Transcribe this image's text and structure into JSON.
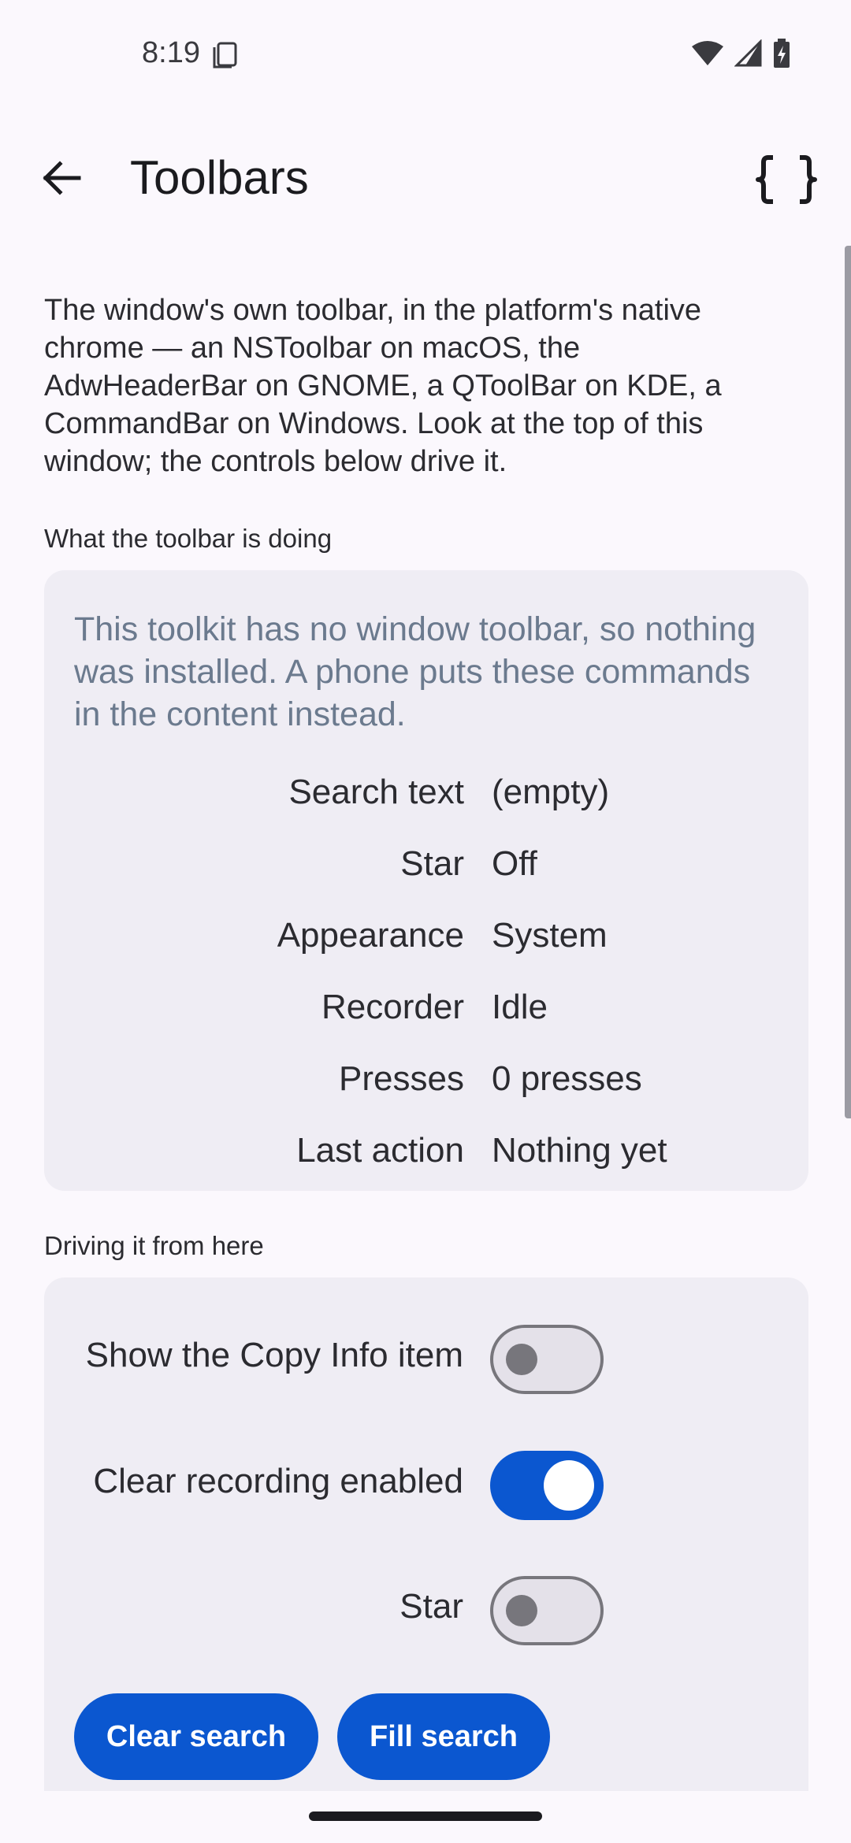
{
  "status_bar": {
    "time": "8:19",
    "icons": [
      "sim-card-icon",
      "wifi-icon",
      "cellular-signal-icon",
      "battery-charging-icon"
    ]
  },
  "app_bar": {
    "title": "Toolbars",
    "back_icon": "arrow-back-icon",
    "action_icon": "curly-braces-icon"
  },
  "intro_text": "The window's own toolbar, in the platform's native chrome — an NSToolbar on macOS, the AdwHeaderBar on GNOME, a QToolBar on KDE, a CommandBar on Windows. Look at the top of this window; the controls below drive it.",
  "status_section": {
    "label": "What the toolbar is doing",
    "message": "This toolkit has no window toolbar, so nothing was installed. A phone puts these commands in the content instead.",
    "rows": [
      {
        "key": "Search text",
        "value": "(empty)"
      },
      {
        "key": "Star",
        "value": "Off"
      },
      {
        "key": "Appearance",
        "value": "System"
      },
      {
        "key": "Recorder",
        "value": "Idle"
      },
      {
        "key": "Presses",
        "value": "0 presses"
      },
      {
        "key": "Last action",
        "value": "Nothing yet"
      }
    ]
  },
  "controls_section": {
    "label": "Driving it from here",
    "toggles": [
      {
        "label": "Show the Copy Info item",
        "state": "off"
      },
      {
        "label": "Clear recording enabled",
        "state": "on"
      },
      {
        "label": "Star",
        "state": "off"
      }
    ],
    "buttons": {
      "clear_search": "Clear search",
      "fill_search": "Fill search"
    }
  },
  "colors": {
    "accent": "#0b57d0",
    "card_background": "#efedf4",
    "page_background": "#fbf8fd",
    "status_message": "#6b7a8e"
  }
}
